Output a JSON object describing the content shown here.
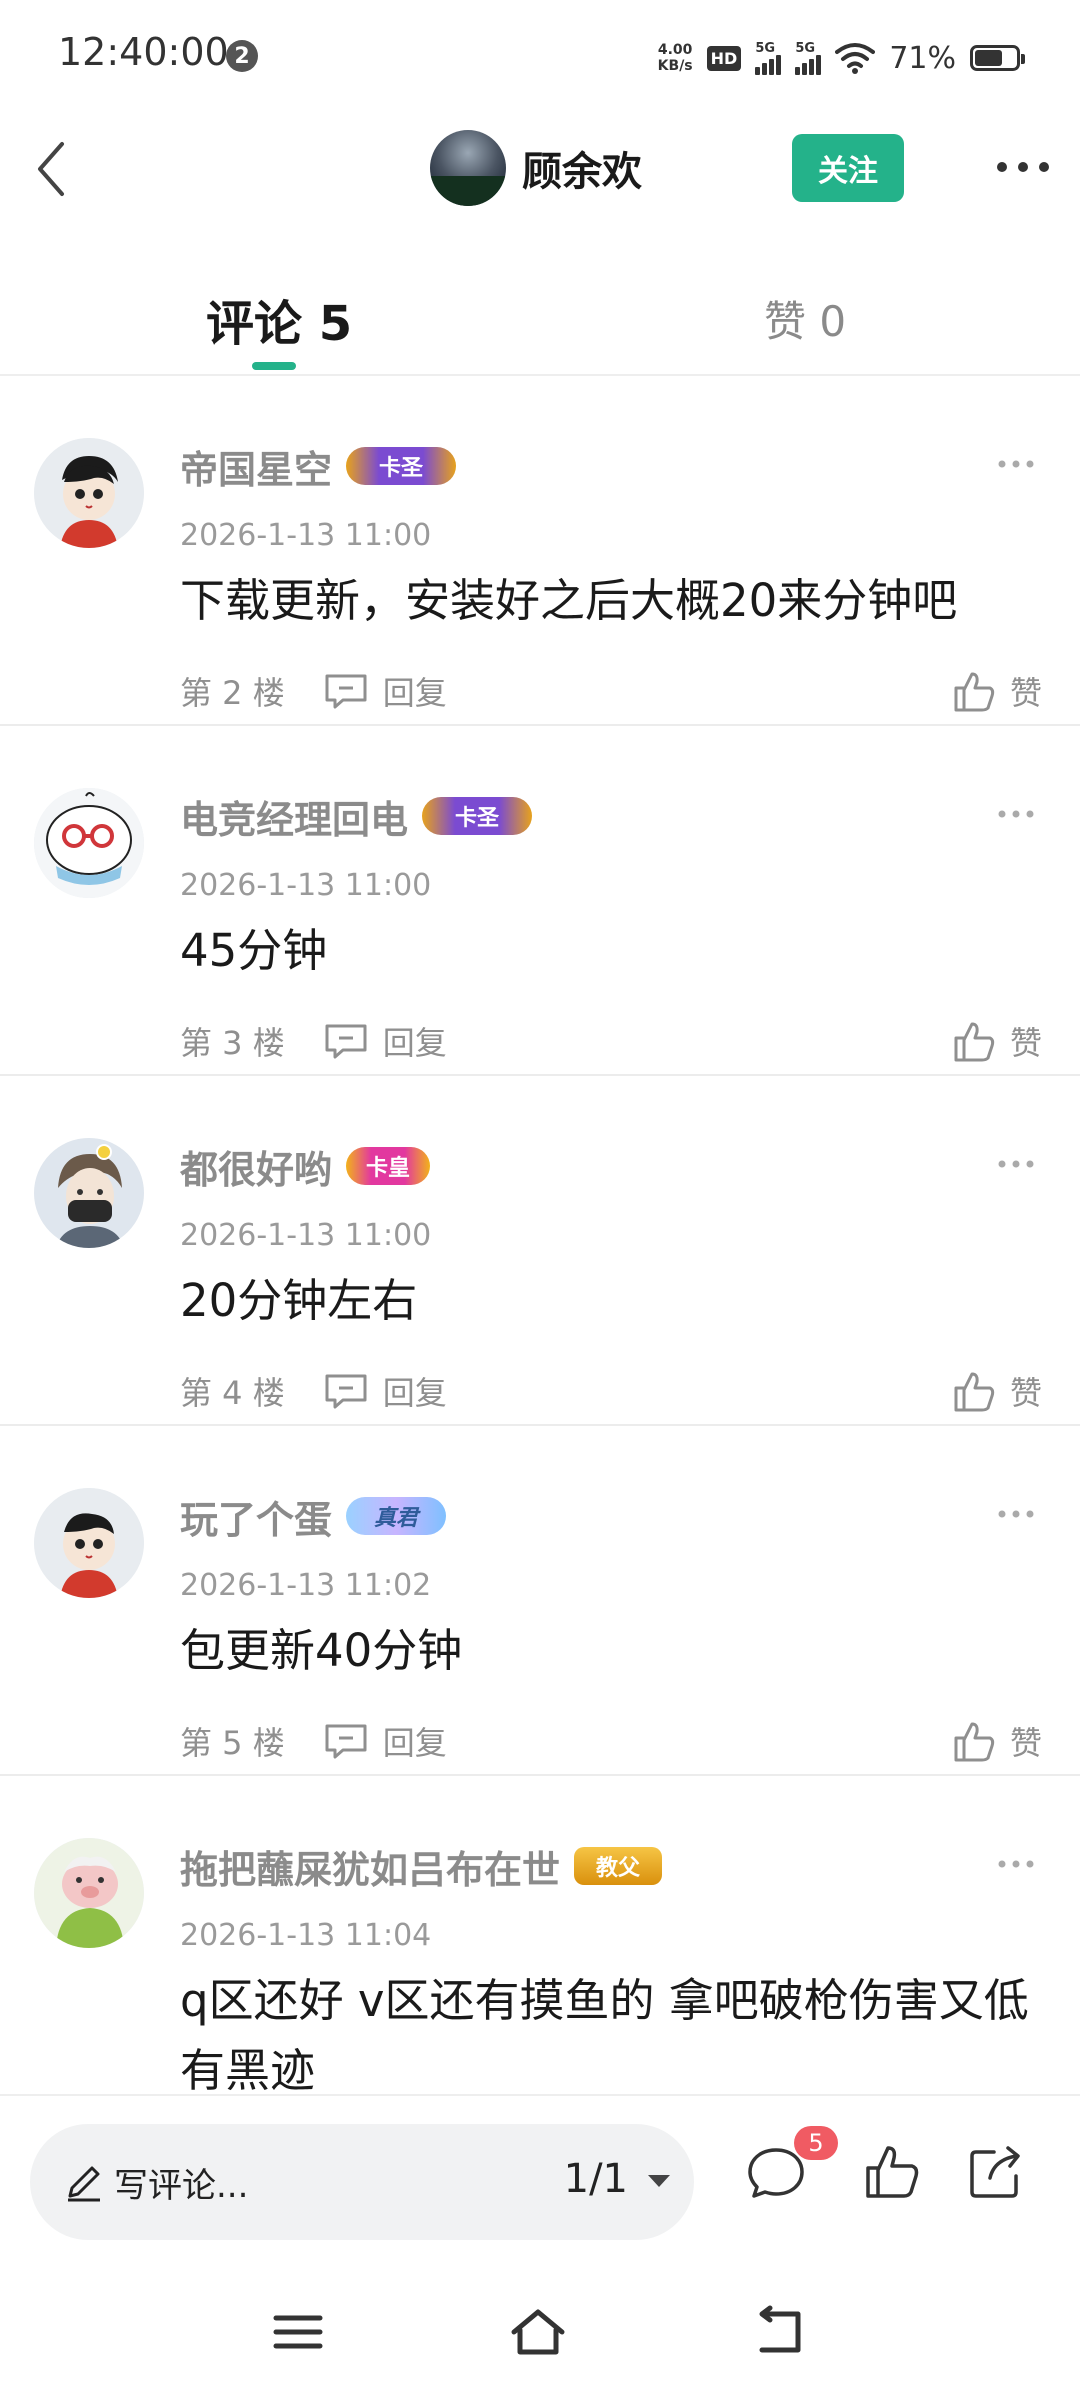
{
  "status_bar": {
    "time": "12:40:00",
    "notification_count": "2",
    "net_speed_value": "4.00",
    "net_speed_unit": "KB/s",
    "hd_label": "HD",
    "signal1_label": "5G",
    "signal2_label": "5G",
    "battery_percent": "71%",
    "battery_level": 0.71
  },
  "header": {
    "author_name": "顾余欢",
    "follow_label": "关注"
  },
  "tabs": {
    "comments_label": "评论 5",
    "likes_label": "赞 0"
  },
  "comments": [
    {
      "name": "帝国星空",
      "badge": "卡圣",
      "badge_style": "saint",
      "time": "2026-1-13 11:00",
      "text": "下载更新，安装好之后大概20来分钟吧",
      "floor": "第 2 楼",
      "reply_label": "回复",
      "like_label": "赞",
      "avatar": "cartoon-boy"
    },
    {
      "name": "电竞经理回电",
      "badge": "卡圣",
      "badge_style": "saint",
      "time": "2026-1-13 11:00",
      "text": "45分钟",
      "floor": "第 3 楼",
      "reply_label": "回复",
      "like_label": "赞",
      "avatar": "cartoon-bun"
    },
    {
      "name": "都很好哟",
      "badge": "卡皇",
      "badge_style": "emperor",
      "time": "2026-1-13 11:00",
      "text": "20分钟左右",
      "floor": "第 4 楼",
      "reply_label": "回复",
      "like_label": "赞",
      "avatar": "anime-masked"
    },
    {
      "name": "玩了个蛋",
      "badge": "真君",
      "badge_style": "immortal",
      "time": "2026-1-13 11:02",
      "text": "包更新40分钟",
      "floor": "第 5 楼",
      "reply_label": "回复",
      "like_label": "赞",
      "avatar": "cartoon-boy"
    },
    {
      "name": "拖把蘸屎犹如吕布在世",
      "badge": "教父",
      "badge_style": "godfather",
      "time": "2026-1-13 11:04",
      "text": "q区还好 v区还有摸鱼的 拿吧破枪伤害又低有黑迹",
      "floor": "",
      "reply_label": "",
      "like_label": "",
      "avatar": "cartoon-pig"
    }
  ],
  "bottom_bar": {
    "input_placeholder": "写评论...",
    "page_indicator": "1/1",
    "comment_count": "5"
  },
  "colors": {
    "accent": "#24b28a",
    "badge_red": "#f05b63"
  }
}
